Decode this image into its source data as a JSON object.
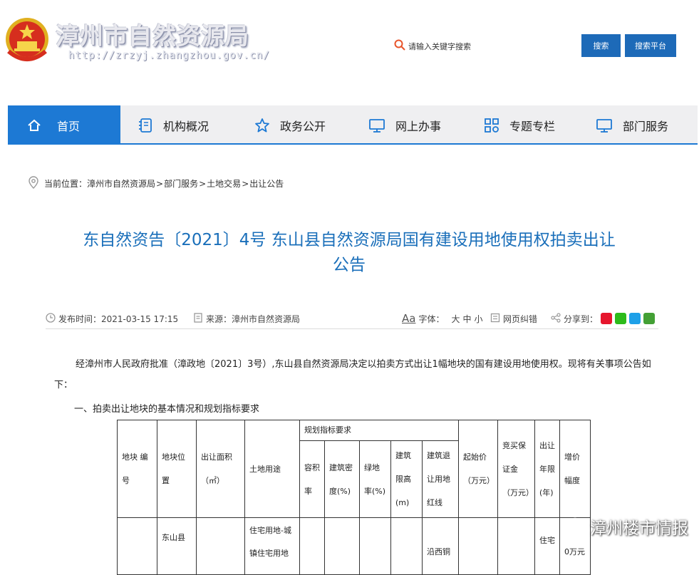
{
  "header": {
    "site_name": "漳州市自然资源局",
    "site_url": "http://zrzyj.zhangzhou.gov.cn/",
    "search_placeholder": "请输入关键字搜索",
    "search_button": "搜索",
    "platform_button": "搜索平台"
  },
  "nav": {
    "items": [
      {
        "label": "首页",
        "icon": "home-icon"
      },
      {
        "label": "机构概况",
        "icon": "document-icon"
      },
      {
        "label": "政务公开",
        "icon": "star-icon"
      },
      {
        "label": "网上办事",
        "icon": "monitor-icon"
      },
      {
        "label": "专题专栏",
        "icon": "grid-icon"
      },
      {
        "label": "部门服务",
        "icon": "monitor-icon"
      }
    ]
  },
  "breadcrumb": {
    "prefix": "当前位置：",
    "items": [
      "漳州市自然资源局",
      "部门服务",
      "土地交易",
      "出让公告"
    ],
    "separator": ">"
  },
  "article": {
    "title_line1": "东自然资告〔2021〕4号 东山县自然资源局国有建设用地使用权拍卖出让",
    "title_line2": "公告",
    "publish_time": "发布时间：2021-03-15 17:15",
    "source": "来源：漳州市自然资源局",
    "font_label": "字体：",
    "font_sizes": [
      "大",
      "中",
      "小"
    ],
    "correction": "网页纠错",
    "share": "分享到：",
    "intro": "经漳州市人民政府批准（漳政地〔2021〕3号）,东山县自然资源局决定以拍卖方式出让1幅地块的国有建设用地使用权。现将有关事项公告如下：",
    "section1": "一、拍卖出让地块的基本情况和规划指标要求"
  },
  "table": {
    "headers": {
      "parcel_no": "地块 编号",
      "location": "地块位置",
      "area": "出让面积（㎡）",
      "usage": "土地用途",
      "planning": "规划指标要求",
      "far": "容积率",
      "density": "建筑密度(%)",
      "green": "绿地率(%)",
      "height": "建筑限高(m)",
      "setback": "建筑退让用地红线",
      "start_price": "起始价（万元）",
      "deposit": "竞买保证金（万元）",
      "term": "出让年限(年)",
      "increment": "增价幅度"
    },
    "row1": {
      "location": "东山县",
      "usage": "住宅用地-城镇住宅用地",
      "setback": "沿西铜",
      "term": "住宅",
      "increment": "0万元"
    }
  },
  "watermark": "漳州楼市情报",
  "colors": {
    "primary": "#1d79d4",
    "title": "#1a6fba",
    "button": "#1d6ab8"
  }
}
